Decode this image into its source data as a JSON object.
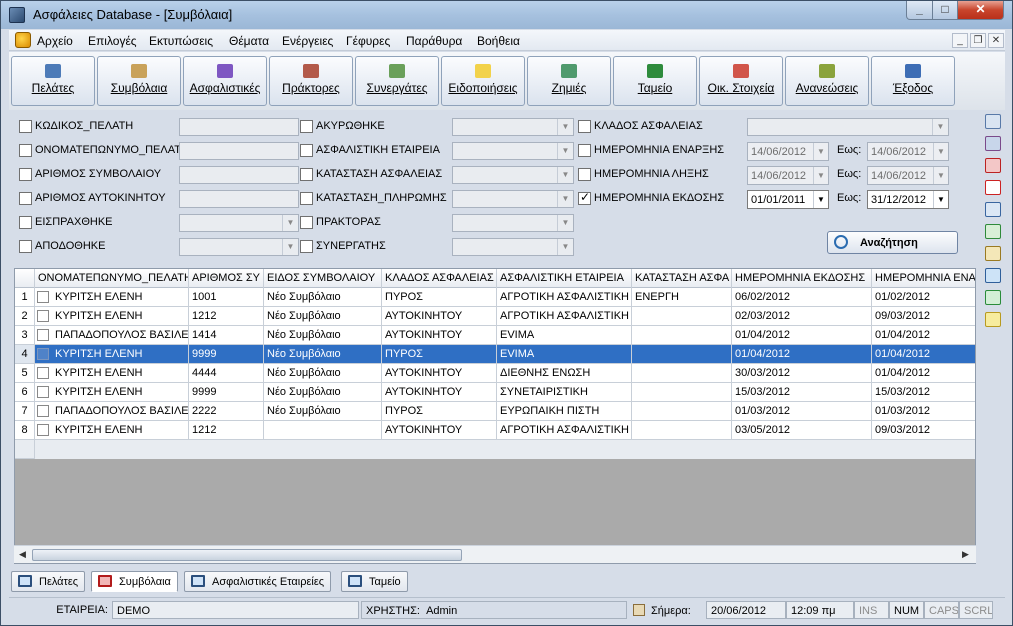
{
  "window": {
    "title": "Ασφάλειες Database - [Συμβόλαια]"
  },
  "menu": [
    "Αρχείο",
    "Επιλογές",
    "Εκτυπώσεις",
    "Θέματα",
    "Ενέργειες",
    "Γέφυρες",
    "Παράθυρα",
    "Βοήθεια"
  ],
  "toolbar": [
    "Πελάτες",
    "Συμβόλαια",
    "Ασφαλιστικές",
    "Πράκτορες",
    "Συνεργάτες",
    "Ειδοποιήσεις",
    "Ζημιές",
    "Ταμείο",
    "Οικ. Στοιχεία",
    "Ανανεώσεις",
    "Έξοδος"
  ],
  "filters": {
    "col1": [
      "ΚΩΔΙΚΟΣ_ΠΕΛΑΤΗ",
      "ΟΝΟΜΑΤΕΠΩΝΥΜΟ_ΠΕΛΑΤΗ",
      "ΑΡΙΘΜΟΣ ΣΥΜΒΟΛΑΙΟΥ",
      "ΑΡΙΘΜΟΣ ΑΥΤΟΚΙΝΗΤΟΥ",
      "ΕΙΣΠΡΑΧΘΗΚΕ",
      "ΑΠΟΔΟΘΗΚΕ"
    ],
    "col2": [
      "ΑΚΥΡΩΘΗΚΕ",
      "ΑΣΦΑΛΙΣΤΙΚΗ ΕΤΑΙΡΕΙΑ",
      "ΚΑΤΑΣΤΑΣΗ ΑΣΦΑΛΕΙΑΣ",
      "ΚΑΤΑΣΤΑΣΗ_ΠΛΗΡΩΜΗΣ",
      "ΠΡΑΚΤΟΡΑΣ",
      "ΣΥΝΕΡΓΑΤΗΣ"
    ],
    "col3": [
      "ΚΛΑΔΟΣ ΑΣΦΑΛΕΙΑΣ",
      "ΗΜΕΡΟΜΗΝΙΑ ΕΝΑΡΞΗΣ",
      "ΗΜΕΡΟΜΗΝΙΑ ΛΗΞΗΣ",
      "ΗΜΕΡΟΜΗΝΙΑ ΕΚΔΟΣΗΣ"
    ],
    "ews": "Εως:",
    "dates": {
      "start_from": "14/06/2012",
      "start_to": "14/06/2012",
      "end_from": "14/06/2012",
      "end_to": "14/06/2012",
      "issue_from": "01/01/2011",
      "issue_to": "31/12/2012"
    },
    "search": "Αναζήτηση"
  },
  "grid": {
    "columns": [
      "ΟΝΟΜΑΤΕΠΩΝΥΜΟ_ΠΕΛΑΤΗ",
      "ΑΡΙΘΜΟΣ ΣΥ",
      "ΕΙΔΟΣ ΣΥΜΒΟΛΑΙΟΥ",
      "ΚΛΑΔΟΣ ΑΣΦΑΛΕΙΑΣ",
      "ΑΣΦΑΛΙΣΤΙΚΗ ΕΤΑΙΡΕΙΑ",
      "ΚΑΤΑΣΤΑΣΗ ΑΣΦΑ",
      "ΗΜΕΡΟΜΗΝΙΑ ΕΚΔΟΣΗΣ",
      "ΗΜΕΡΟΜΗΝΙΑ ΕΝΑΡ"
    ],
    "rows": [
      [
        "1",
        "ΚΥΡΙΤΣΗ ΕΛΕΝΗ",
        "1001",
        "Νέο Συμβόλαιο",
        "ΠΥΡΟΣ",
        "ΑΓΡΟΤΙΚΗ ΑΣΦΑΛΙΣΤΙΚΗ",
        "ΕΝΕΡΓΗ",
        "06/02/2012",
        "01/02/2012"
      ],
      [
        "2",
        "ΚΥΡΙΤΣΗ ΕΛΕΝΗ",
        "1212",
        "Νέο Συμβόλαιο",
        "ΑΥΤΟΚΙΝΗΤΟΥ",
        "ΑΓΡΟΤΙΚΗ ΑΣΦΑΛΙΣΤΙΚΗ",
        "",
        "02/03/2012",
        "09/03/2012"
      ],
      [
        "3",
        "ΠΑΠΑΔΟΠΟΥΛΟΣ ΒΑΣΙΛΕΙΟΣ",
        "1414",
        "Νέο Συμβόλαιο",
        "ΑΥΤΟΚΙΝΗΤΟΥ",
        "EVIMA",
        "",
        "01/04/2012",
        "01/04/2012"
      ],
      [
        "4",
        "ΚΥΡΙΤΣΗ ΕΛΕΝΗ",
        "9999",
        "Νέο Συμβόλαιο",
        "ΠΥΡΟΣ",
        "EVIMA",
        "",
        "01/04/2012",
        "01/04/2012"
      ],
      [
        "5",
        "ΚΥΡΙΤΣΗ ΕΛΕΝΗ",
        "4444",
        "Νέο Συμβόλαιο",
        "ΑΥΤΟΚΙΝΗΤΟΥ",
        "ΔΙΕΘΝΗΣ ΕΝΩΣΗ",
        "",
        "30/03/2012",
        "01/04/2012"
      ],
      [
        "6",
        "ΚΥΡΙΤΣΗ ΕΛΕΝΗ",
        "9999",
        "Νέο Συμβόλαιο",
        "ΑΥΤΟΚΙΝΗΤΟΥ",
        "ΣΥΝΕΤΑΙΡΙΣΤΙΚΗ",
        "",
        "15/03/2012",
        "15/03/2012"
      ],
      [
        "7",
        "ΠΑΠΑΔΟΠΟΥΛΟΣ ΒΑΣΙΛΕΙΟΣ",
        "2222",
        "Νέο Συμβόλαιο",
        "ΠΥΡΟΣ",
        "ΕΥΡΩΠΑΙΚΗ ΠΙΣΤΗ",
        "",
        "01/03/2012",
        "01/03/2012"
      ],
      [
        "8",
        "ΚΥΡΙΤΣΗ ΕΛΕΝΗ",
        "1212",
        "",
        "ΑΥΤΟΚΙΝΗΤΟΥ",
        "ΑΓΡΟΤΙΚΗ ΑΣΦΑΛΙΣΤΙΚΗ",
        "",
        "03/05/2012",
        "09/03/2012"
      ]
    ]
  },
  "tabs": [
    "Πελάτες",
    "Συμβόλαια",
    "Ασφαλιστικές Εταιρείες",
    "Ταμείο"
  ],
  "status": {
    "company_label": "ΕΤΑΙΡΕΙΑ:",
    "company": "DEMO",
    "user_label": "ΧΡΗΣΤΗΣ:",
    "user": "Admin",
    "today_label": "Σήμερα:",
    "today": "20/06/2012",
    "time": "12:09 πμ",
    "ins": "INS",
    "num": "NUM",
    "caps": "CAPS",
    "scrl": "SCRL"
  }
}
